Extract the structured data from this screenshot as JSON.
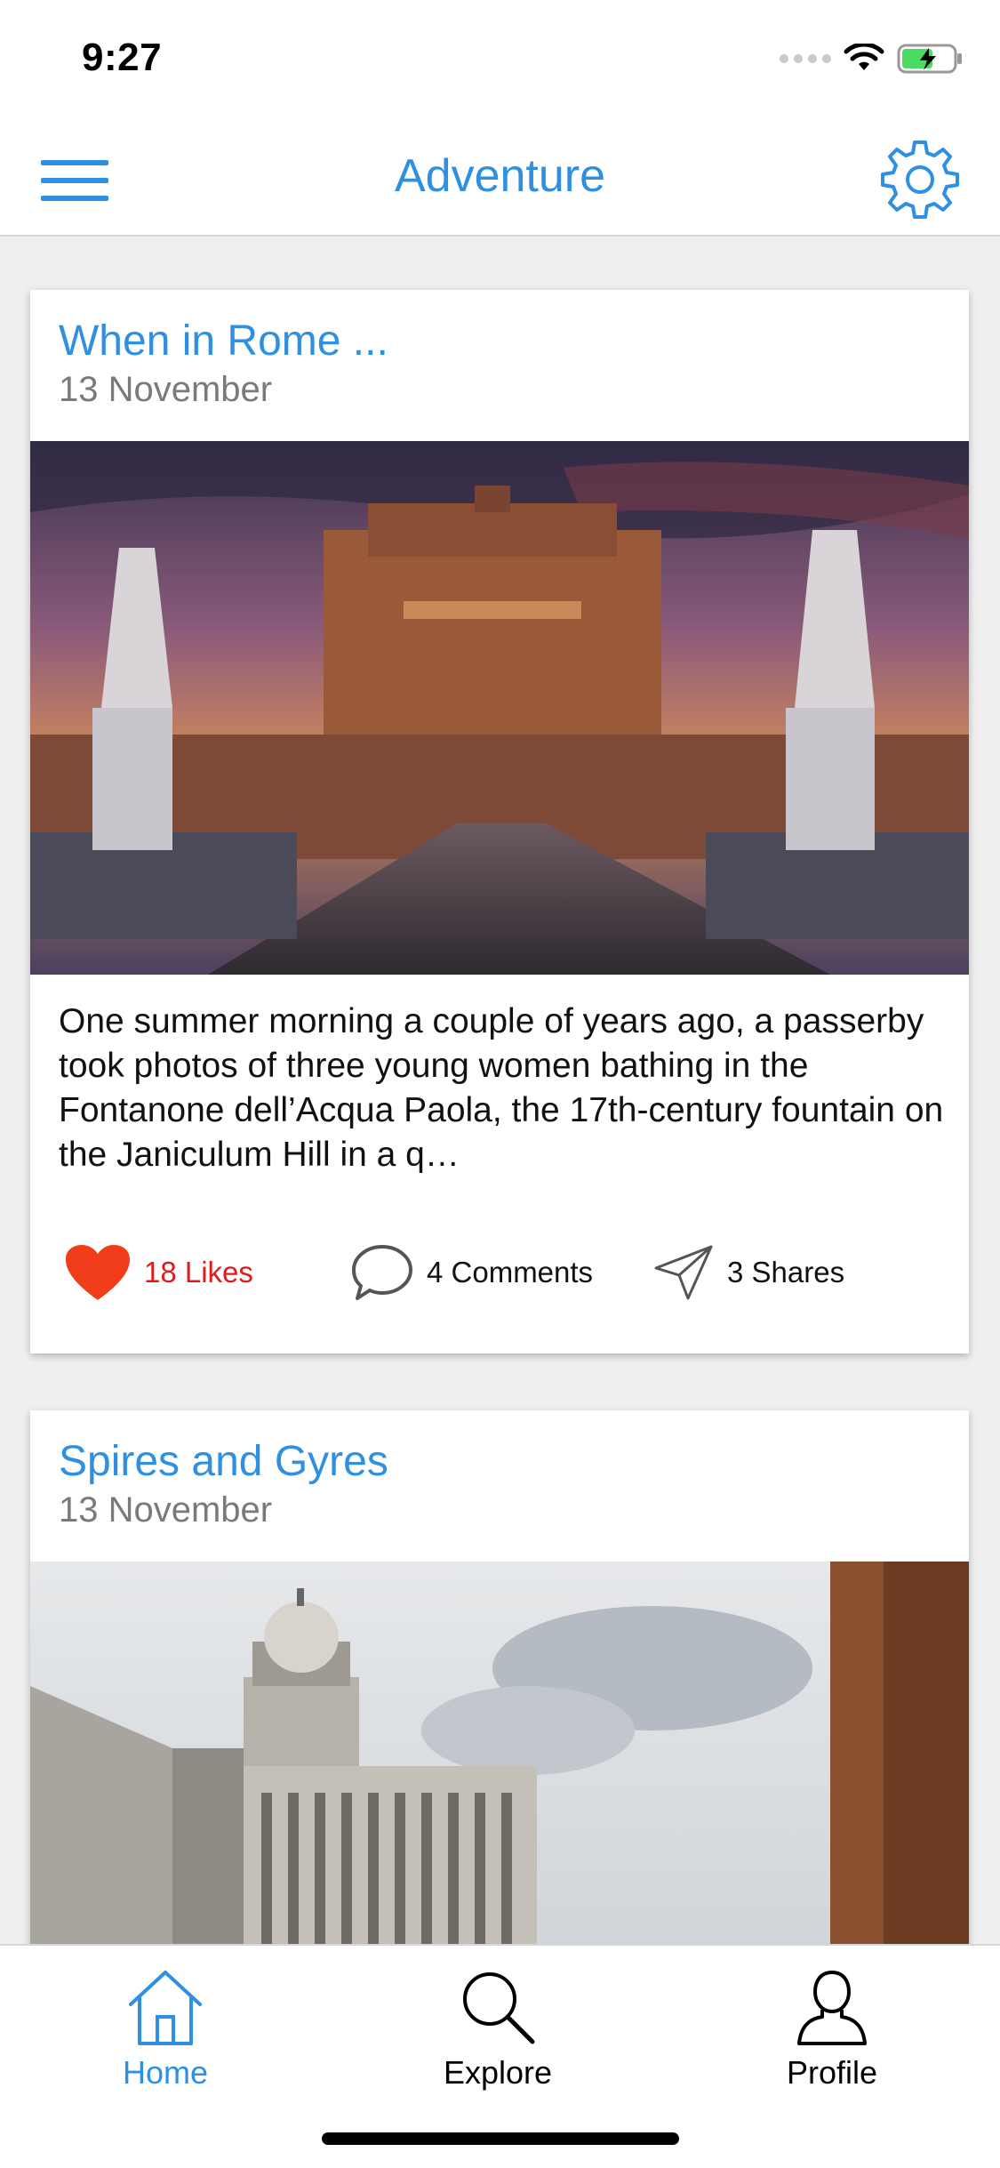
{
  "status_bar": {
    "time": "9:27"
  },
  "nav": {
    "title": "Adventure",
    "menu_icon": "hamburger-menu-icon",
    "settings_icon": "gear-icon"
  },
  "colors": {
    "accent": "#2f8fe0",
    "like": "#e01b1b",
    "muted": "#7a7a7a"
  },
  "posts": [
    {
      "title": "When in Rome ...",
      "date": "13 November",
      "image": "castel-sant-angelo-photo",
      "excerpt": "One summer morning a couple of years ago, a passerby took photos of three young women bathing in the Fontanone dell’Acqua Paola, the 17th-century fountain on the Janiculum Hill in a q…",
      "likes": "18 Likes",
      "comments": "4 Comments",
      "shares": "3 Shares"
    },
    {
      "title": "Spires and Gyres",
      "date": "13 November",
      "image": "modernist-mosque-photo"
    }
  ],
  "tabs": [
    {
      "label": "Home",
      "icon": "home-icon"
    },
    {
      "label": "Explore",
      "icon": "search-icon"
    },
    {
      "label": "Profile",
      "icon": "person-icon"
    }
  ]
}
